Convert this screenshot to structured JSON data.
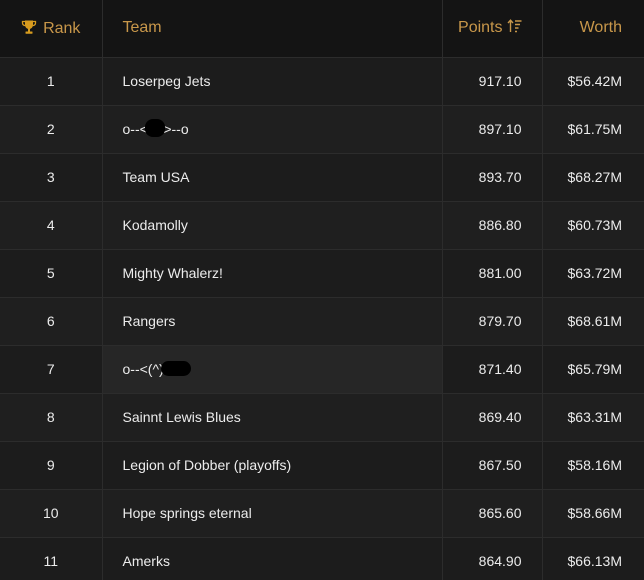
{
  "header": {
    "rank_label": "Rank",
    "team_label": "Team",
    "points_label": "Points",
    "worth_label": "Worth",
    "accent_color": "#c8974a",
    "rank_icon": "trophy-icon",
    "points_sort_icon": "sort-descending-icon"
  },
  "rows": [
    {
      "rank": "1",
      "team": "Loserpeg Jets",
      "points": "917.10",
      "worth": "$56.42M"
    },
    {
      "rank": "2",
      "team": "o--<    >--o",
      "points": "897.10",
      "worth": "$61.75M",
      "redacted": true
    },
    {
      "rank": "3",
      "team": "Team USA",
      "points": "893.70",
      "worth": "$68.27M"
    },
    {
      "rank": "4",
      "team": "Kodamolly",
      "points": "886.80",
      "worth": "$60.73M"
    },
    {
      "rank": "5",
      "team": "Mighty Whalerz!",
      "points": "881.00",
      "worth": "$63.72M"
    },
    {
      "rank": "6",
      "team": "Rangers",
      "points": "879.70",
      "worth": "$68.61M"
    },
    {
      "rank": "7",
      "team": "o--<(^)",
      "points": "871.40",
      "worth": "$65.79M",
      "redacted": true,
      "highlighted": true
    },
    {
      "rank": "8",
      "team": "Sainnt Lewis Blues",
      "points": "869.40",
      "worth": "$63.31M"
    },
    {
      "rank": "9",
      "team": "Legion of Dobber (playoffs)",
      "points": "867.50",
      "worth": "$58.16M"
    },
    {
      "rank": "10",
      "team": "Hope springs eternal",
      "points": "865.60",
      "worth": "$58.66M"
    },
    {
      "rank": "11",
      "team": "Amerks",
      "points": "864.90",
      "worth": "$66.13M"
    }
  ]
}
